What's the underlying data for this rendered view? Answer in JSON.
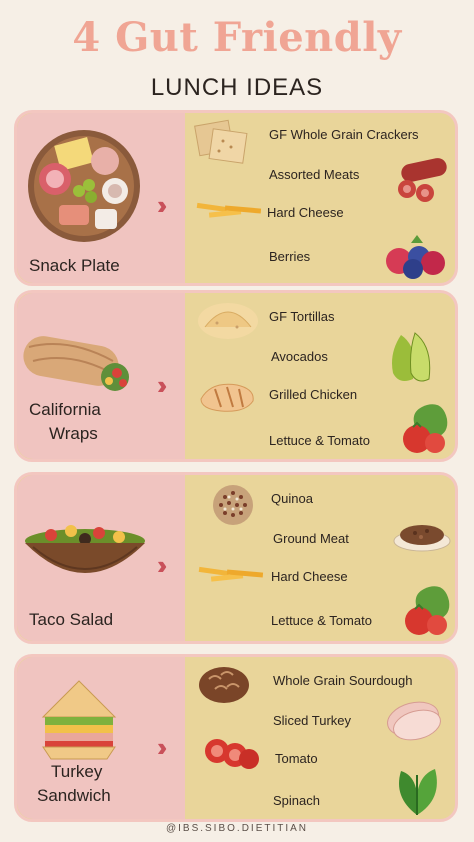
{
  "header": {
    "title": "4 Gut Friendly",
    "subtitle": "LUNCH IDEAS"
  },
  "cards": [
    {
      "name": "Snack Plate",
      "ingredients": [
        "GF Whole Grain Crackers",
        "Assorted Meats",
        "Hard Cheese",
        "Berries"
      ]
    },
    {
      "name_lines": [
        "California",
        "Wraps"
      ],
      "ingredients": [
        "GF Tortillas",
        "Avocados",
        "Grilled Chicken",
        "Lettuce & Tomato"
      ]
    },
    {
      "name": "Taco Salad",
      "ingredients": [
        "Quinoa",
        "Ground Meat",
        "Hard Cheese",
        "Lettuce & Tomato"
      ]
    },
    {
      "name_lines": [
        "Turkey",
        "Sandwich"
      ],
      "ingredients": [
        "Whole Grain Sourdough",
        "Sliced Turkey",
        "Tomato",
        "Spinach"
      ]
    }
  ],
  "footer": "@IBS.SIBO.DIETITIAN",
  "colors": {
    "title": "#f0a594",
    "card_bg": "#e9d59a",
    "card_left": "#f0c4c0",
    "arrow": "#c9515a",
    "page_bg": "#f6efe6"
  },
  "icons": [
    "crackers-icon",
    "salami-icon",
    "cheese-icon",
    "berries-icon",
    "tortillas-icon",
    "avocado-icon",
    "chicken-icon",
    "lettuce-tomato-icon",
    "quinoa-icon",
    "ground-meat-icon",
    "sourdough-icon",
    "sliced-turkey-icon",
    "tomato-slices-icon",
    "spinach-icon"
  ]
}
